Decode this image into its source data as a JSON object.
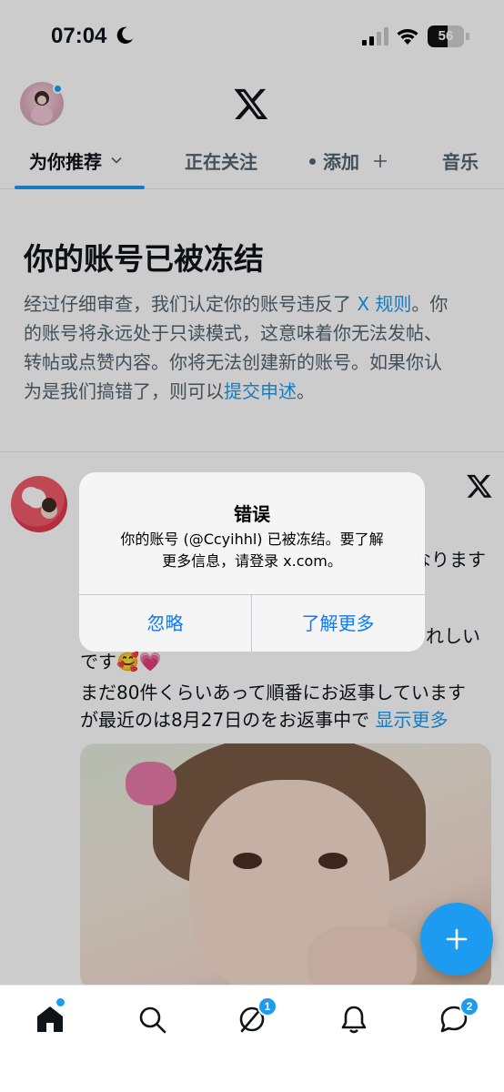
{
  "status_bar": {
    "time": "07:04",
    "battery_level": "56"
  },
  "header": {
    "logo_icon": "x-logo-icon",
    "avatar_has_notification": true
  },
  "tabs": [
    {
      "label": "为你推荐",
      "active": true
    },
    {
      "label": "正在关注",
      "active": false
    },
    {
      "label": "添加",
      "active": false
    },
    {
      "label": "音乐",
      "active": false
    }
  ],
  "notice": {
    "title": "你的账号已被冻结",
    "body_line1_a": "经过仔细审查，我们认定你的账号违反了 ",
    "body_line1_link": "X 规则",
    "body_line1_b": "。你",
    "body_line2": "的账号将永远处于只读模式，这意味着你无法发帖、",
    "body_line3": "转帖或点赞内容。你将无法创建新的账号。如果你认",
    "body_line4_a": "为是我们搞错了，则可以",
    "body_line4_link": "提交申述",
    "body_line4_b": "。"
  },
  "post": {
    "line_partial_1": "なります",
    "line_partial_2": "れしい",
    "line_3": "です🥰💗",
    "line_4": "まだ80件くらいあって順番にお返事しています",
    "line_5_a": "が最近のは8月27日のをお返事中で ",
    "line_5_link": "显示更多"
  },
  "alert": {
    "title": "错误",
    "message_line1": "你的账号 (@Ccyihhl) 已被冻结。要了解",
    "message_line2": "更多信息，请登录 x.com。",
    "dismiss_label": "忽略",
    "learn_more_label": "了解更多"
  },
  "bottom_nav": {
    "items": [
      "home",
      "search",
      "grok",
      "notifications",
      "messages"
    ],
    "grok_badge": "1",
    "messages_badge": "2"
  },
  "colors": {
    "accent": "#1d9bf0",
    "ios_button": "#0a7aff",
    "text_primary": "#0f1419",
    "text_secondary": "#536471"
  }
}
